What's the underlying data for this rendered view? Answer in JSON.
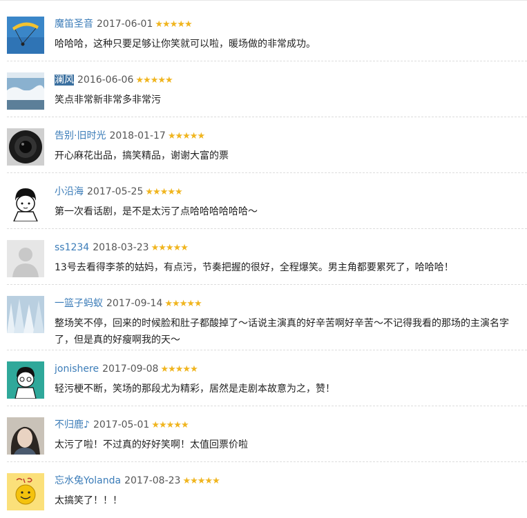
{
  "comments": [
    {
      "user": "魔笛圣音",
      "date": "2017-06-01",
      "rating": 5,
      "text": "哈哈哈，这种只要足够让你笑就可以啦，暖场做的非常成功。",
      "avatar": "avatar-paraglider"
    },
    {
      "user": "澜风",
      "date": "2016-06-06",
      "rating": 5,
      "text": "笑点非常新非常多非常污",
      "avatar": "avatar-sea-waves",
      "highlighted": true
    },
    {
      "user": "告别·旧时光",
      "date": "2018-01-17",
      "rating": 5,
      "text": "开心麻花出品，搞笑精品，谢谢大富的票",
      "avatar": "avatar-camera-lens"
    },
    {
      "user": "小沿海",
      "date": "2017-05-25",
      "rating": 5,
      "text": "第一次看话剧，是不是太污了点哈哈哈哈哈哈～",
      "avatar": "avatar-cartoon-boy"
    },
    {
      "user": "ss1234",
      "date": "2018-03-23",
      "rating": 5,
      "text": "13号去看得李茶的姑妈，有点污，节奏把握的很好，全程爆笑。男主角都要累死了，哈哈哈！",
      "avatar": "avatar-default-person"
    },
    {
      "user": "一篮子蚂蚁",
      "date": "2017-09-14",
      "rating": 5,
      "text": "整场笑不停，回来的时候脸和肚子都酸掉了～话说主演真的好辛苦啊好辛苦～不记得我看的那场的主演名字了，但是真的好瘦啊我的天～",
      "avatar": "avatar-frozen-waterfall"
    },
    {
      "user": "jonishere",
      "date": "2017-09-08",
      "rating": 5,
      "text": "轻污梗不断，笑场的那段尤为精彩，居然是走剧本故意为之，赞！",
      "avatar": "avatar-cartoon-teal"
    },
    {
      "user": "不归鹿♪",
      "date": "2017-05-01",
      "rating": 5,
      "text": "太污了啦！不过真的好好笑啊！太值回票价啦",
      "avatar": "avatar-girl-photo"
    },
    {
      "user": "忘水兔Yolanda",
      "date": "2017-08-23",
      "rating": 5,
      "text": "太搞笑了！！！",
      "avatar": "avatar-smile-face"
    }
  ],
  "star_glyph": "★",
  "colors": {
    "username": "#3b7cb8",
    "star": "#f0b51f",
    "highlight": "#3a6f9f"
  }
}
